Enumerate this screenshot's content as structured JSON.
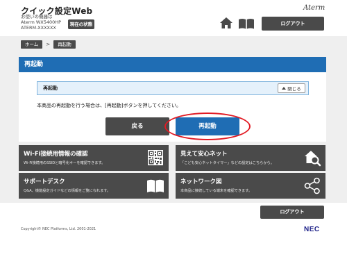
{
  "header": {
    "app_title": "クイック設定Web",
    "device_line1": "お使いの機器は",
    "device_line2": "Aterm WX5400HP",
    "device_line3": "ATERM-XXXXXX",
    "status_button": "現在の状態",
    "brand": "Aterm",
    "home_icon": "home-icon",
    "manual_icon": "book-icon",
    "logout_button": "ログアウト"
  },
  "breadcrumb": {
    "home": "ホーム",
    "separator": ">",
    "current": "再起動"
  },
  "page": {
    "title": "再起動",
    "section_title": "再起動",
    "collapse_label": "閉じる",
    "instruction": "本商品の再起動を行う場合は、[再起動]ボタンを押してください。",
    "back_button": "戻る",
    "restart_button": "再起動",
    "highlight_color": "#e21a23",
    "accent_color": "#1f6db4"
  },
  "tiles": [
    {
      "title": "Wi-Fi接続用情報の確認",
      "desc": "Wi-Fi接続用のSSIDと暗号化キーを確認できます。",
      "icon": "qr-code-icon"
    },
    {
      "title": "見えて安心ネット",
      "desc": "「こども安心ネットタイマー」などの設定はこちらから。",
      "icon": "home-search-icon"
    },
    {
      "title": "サポートデスク",
      "desc": "Q&A、機能設定ガイドなどの情報をご覧になれます。",
      "icon": "open-book-icon"
    },
    {
      "title": "ネットワーク図",
      "desc": "本商品に接続している端末を確認できます。",
      "icon": "network-icon"
    }
  ],
  "footer": {
    "logout_button": "ログアウト",
    "copyright": "Copyright© NEC Platforms, Ltd. 2001-2021",
    "logo": "NEC"
  }
}
